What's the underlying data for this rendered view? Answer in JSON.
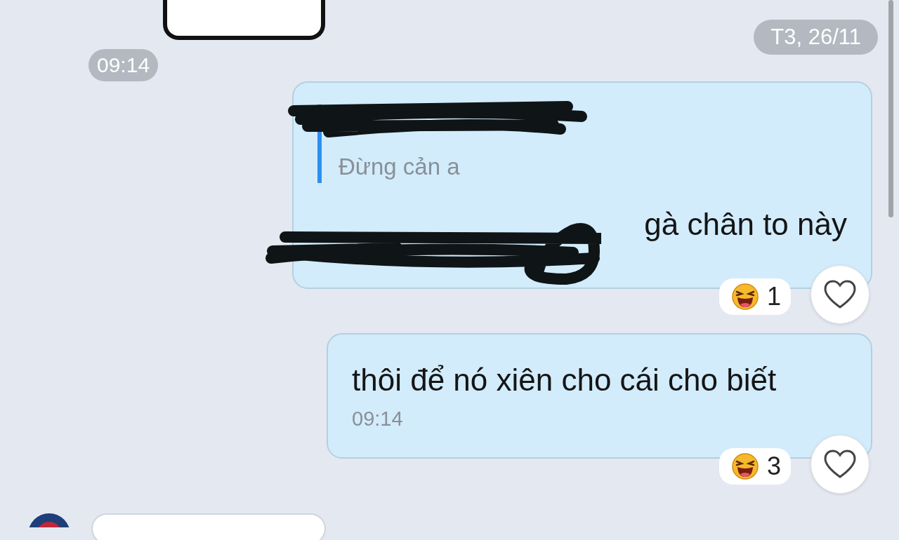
{
  "earlier_message": {
    "time": "09:14"
  },
  "date_divider": "T3, 26/11",
  "messages": [
    {
      "kind": "reply",
      "quote_text": "Đừng cản a",
      "text": "gà chân to này",
      "reaction": {
        "count": "1"
      },
      "liked": false
    },
    {
      "kind": "text",
      "text": "thôi để nó xiên cho cái cho biết",
      "time": "09:14",
      "reaction": {
        "count": "3"
      },
      "liked": false
    }
  ]
}
